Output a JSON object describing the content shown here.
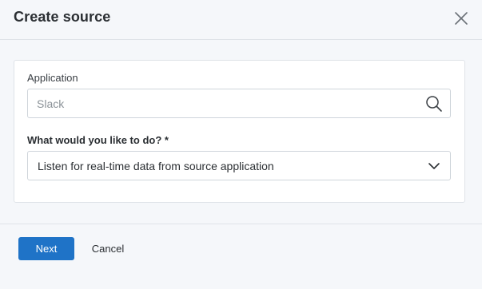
{
  "dialog": {
    "title": "Create source",
    "close_icon": "close-icon"
  },
  "form": {
    "application": {
      "label": "Application",
      "placeholder": "Slack",
      "value": "",
      "icon": "search-icon"
    },
    "action": {
      "label": "What would you like to do? *",
      "selected": "Listen for real-time data from source application",
      "icon": "chevron-down-icon"
    }
  },
  "footer": {
    "next_label": "Next",
    "cancel_label": "Cancel"
  },
  "colors": {
    "primary": "#1f73c7",
    "background": "#f5f7fa",
    "border": "#dfe3e8"
  }
}
